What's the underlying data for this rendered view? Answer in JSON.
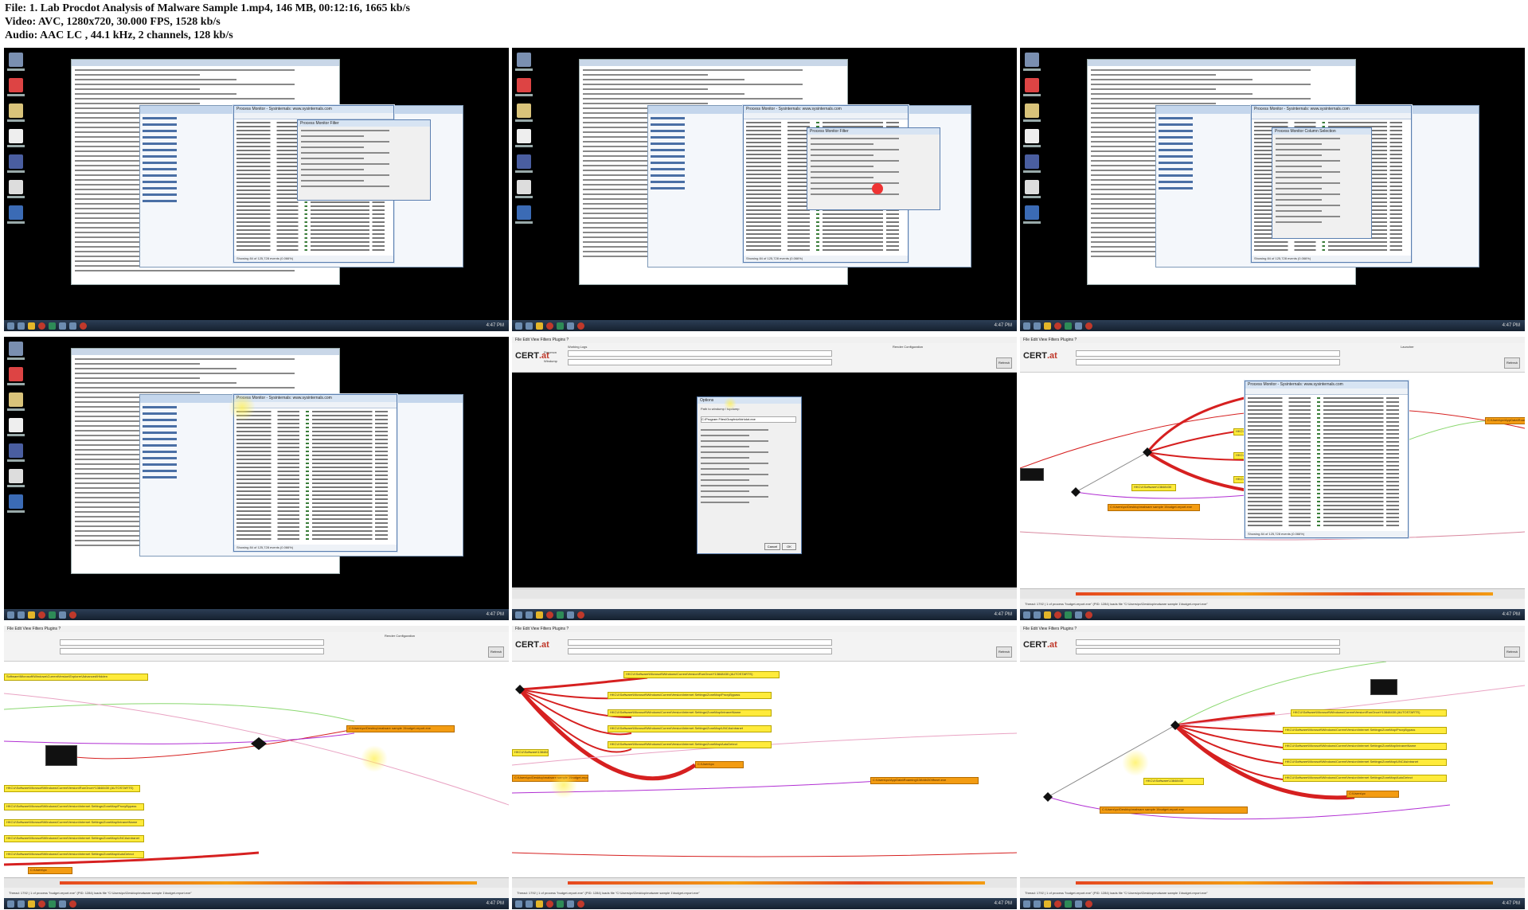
{
  "header": {
    "file_line": "File: 1. Lab Procdot Analysis of Malware Sample 1.mp4, 146 MB, 00:12:16, 1665 kb/s",
    "video_line": "Video: AVC, 1280x720, 30.000 FPS, 1528 kb/s",
    "audio_line": "Audio: AAC LC , 44.1 kHz, 2 channels, 128 kb/s"
  },
  "colors": {
    "desktop_bg": "#000000",
    "graph_edge_red": "#d62020",
    "graph_node_yellow": "#ffeb3b",
    "graph_node_orange": "#f39c12",
    "highlight": "#fff050"
  },
  "procmon": {
    "title": "Process Monitor - Sysinternals: www.sysinternals.com",
    "status": "Showing 84 of 125,728 events (0.066%)",
    "memory": "Backed by virtual memory",
    "filter_dialog_title": "Process Monitor Filter",
    "columns_dialog_title": "Process Monitor Column Selection",
    "menu": "File  Edit  Event  Filter  Tools  Options  Help"
  },
  "procdot": {
    "menu": "File  Edit  View  Filters  Plugins  ?",
    "logo_text": "CERT",
    "logo_suffix": ".at",
    "working_logs": "Working Logs",
    "procmon_label": "Procmon",
    "windump_label": "Windump",
    "render_config": "Render Configuration",
    "launcher_label": "Launcher",
    "refresh": "Refresh",
    "nodes": {
      "explorer_hidden": "Software\\Microsoft\\Windows\\CurrentVersion\\Explorer\\Advanced\\Hidden",
      "run_once": "HKCU\\Software\\Microsoft\\Windows\\CurrentVersion\\RunOnce\\*13848430 (AUTOSTARTS)",
      "proxy_bypass": "HKCU\\Software\\Microsoft\\Windows\\CurrentVersion\\Internet Settings\\ZoneMap\\ProxyBypass",
      "intranet_name": "HKCU\\Software\\Microsoft\\Windows\\CurrentVersion\\Internet Settings\\ZoneMap\\IntranetName",
      "unc_as_intranet": "HKCU\\Software\\Microsoft\\Windows\\CurrentVersion\\Internet Settings\\ZoneMap\\UNCAsIntranet",
      "auto_detect": "HKCU\\Software\\Microsoft\\Windows\\CurrentVersion\\Internet Settings\\ZoneMap\\AutoDetect",
      "appdata_exe": "C:\\Users\\pc\\AppData\\Roaming\\13848430\\ffnnet.exe",
      "budget_exe": "C:\\Users\\pc\\Desktop\\malware sample 1\\budget-report.exe",
      "hkcu_13848430": "HKCU\\Software\\13848430",
      "users_pc": "C:\\Users\\pc",
      "pagefile": "ffnnet.exe, LOG1"
    },
    "options_dialog": {
      "title": "Options",
      "path_label": "Path to windump / tcpdump",
      "procmon_path": "C:\\Program Files\\Graphviz\\bin\\dot.exe",
      "ok": "OK",
      "cancel": "Cancel"
    },
    "status_bar": "Thread: 1792 | 1 of process \"budget-report.exe\" (PID: 1284) loads file \"C:\\Users\\pc\\Desktop\\malware sample 1\\budget-report.exe\""
  },
  "taskbar": {
    "clock": "4:47 PM"
  }
}
